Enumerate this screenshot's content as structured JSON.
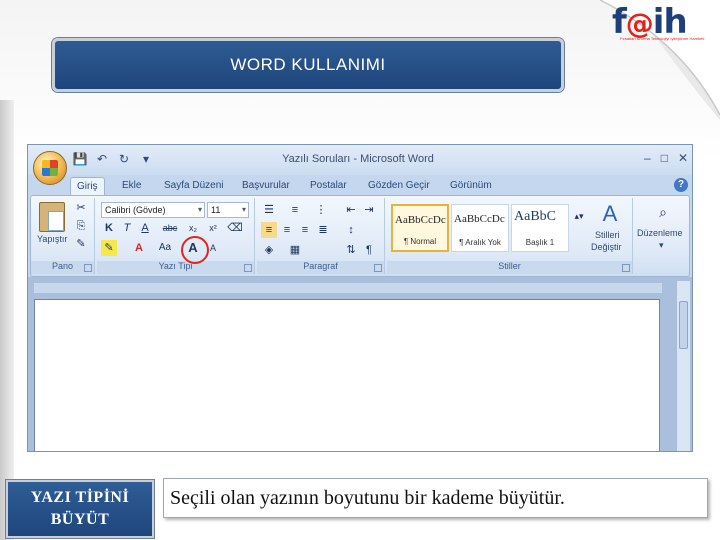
{
  "slide": {
    "title": "WORD KULLANIMI",
    "caption": "YAZI TİPİNİ BÜYÜT",
    "caption_line1": "YAZI TİPİNİ",
    "caption_line2": "BÜYÜT",
    "description": "Seçili olan yazının boyutunu bir kademe büyütür."
  },
  "logo": {
    "text_prefix": "f",
    "text_at": "@",
    "text_suffix": "ih",
    "subtitle": "Fırsatları Artırma Teknolojiyi İyileştirme Hareketi"
  },
  "word_window": {
    "title": "Yazılı Soruları - Microsoft Word",
    "tabs": [
      "Giriş",
      "Ekle",
      "Sayfa Düzeni",
      "Başvurular",
      "Postalar",
      "Gözden Geçir",
      "Görünüm"
    ],
    "active_tab": "Giriş",
    "groups": {
      "clipboard": "Pano",
      "font": "Yazı Tipi",
      "paragraph": "Paragraf",
      "styles": "Stiller"
    },
    "paste_label": "Yapıştır",
    "font_name": "Calibri (Gövde)",
    "font_size": "11",
    "styles": [
      {
        "sample": "AaBbCcDc",
        "name": "¶ Normal",
        "selected": true
      },
      {
        "sample": "AaBbCcDc",
        "name": "¶ Aralık Yok",
        "selected": false
      },
      {
        "sample": "AaBbC",
        "name": "Başlık 1",
        "selected": false
      }
    ],
    "change_styles_label_1": "Stilleri",
    "change_styles_label_2": "Değiştir",
    "editing_label": "Düzenleme"
  },
  "colors": {
    "banner": "#1e467c",
    "highlight_circle": "#e0261c",
    "selected_style": "#e7b33d"
  }
}
